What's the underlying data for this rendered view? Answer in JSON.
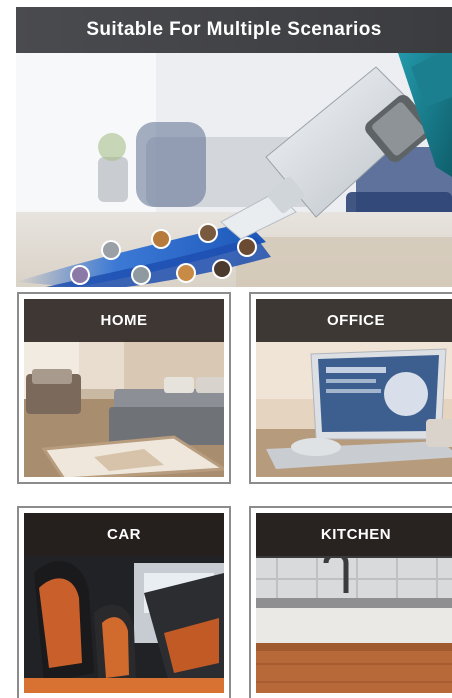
{
  "banner": {
    "title": "Suitable For Multiple Scenarios"
  },
  "scenarios": [
    {
      "label": "HOME"
    },
    {
      "label": "OFFICE"
    },
    {
      "label": "CAR"
    },
    {
      "label": "KITCHEN"
    }
  ],
  "colors": {
    "title_bar": "#3f4044",
    "label_overlay": "#26201e",
    "vacuum_accent": "#1b7f8f",
    "airflow": "#1f5fc2"
  }
}
